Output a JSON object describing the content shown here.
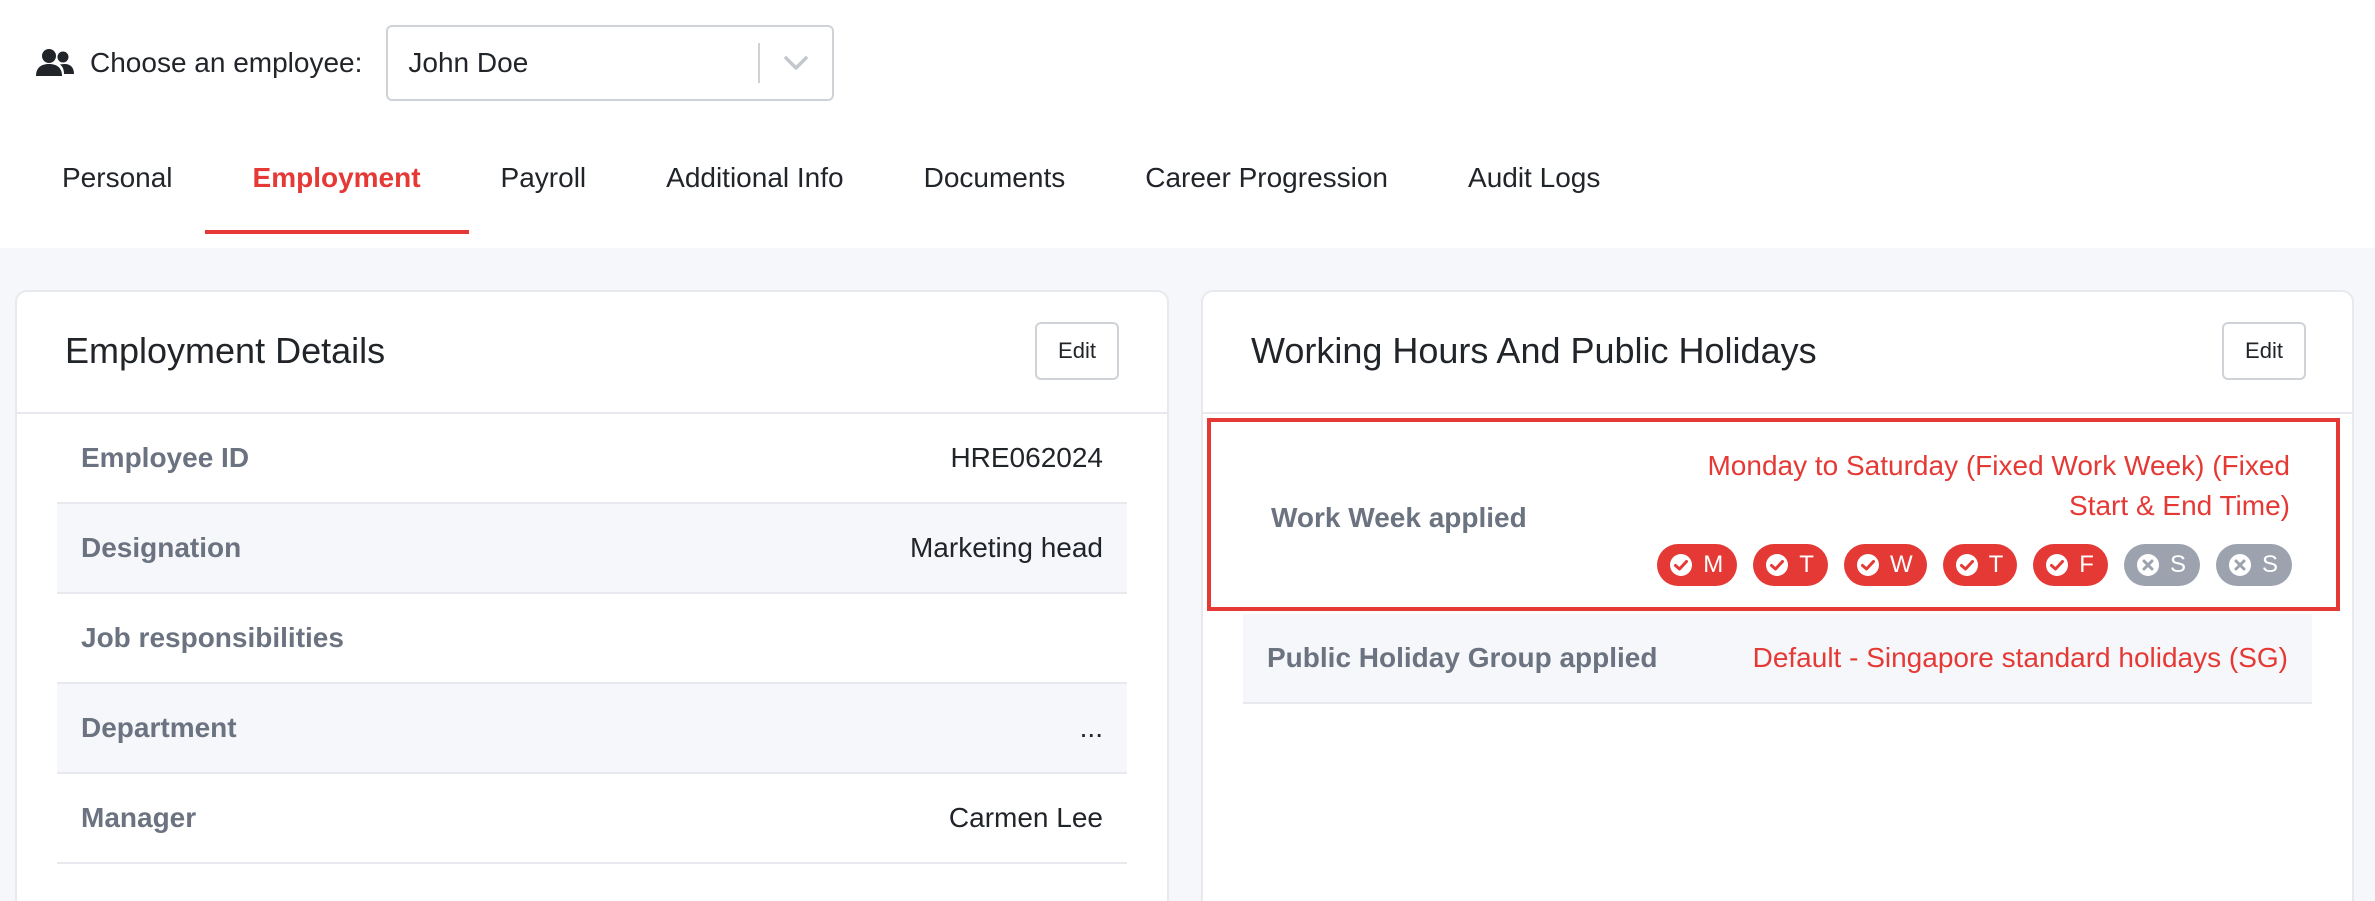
{
  "employee_select": {
    "label": "Choose an employee:",
    "selected": "John Doe",
    "icon": "people-icon",
    "chevron_icon": "chevron-down-icon"
  },
  "tabs": [
    {
      "label": "Personal",
      "active": false
    },
    {
      "label": "Employment",
      "active": true
    },
    {
      "label": "Payroll",
      "active": false
    },
    {
      "label": "Additional Info",
      "active": false
    },
    {
      "label": "Documents",
      "active": false
    },
    {
      "label": "Career Progression",
      "active": false
    },
    {
      "label": "Audit Logs",
      "active": false
    }
  ],
  "employment_details": {
    "title": "Employment Details",
    "edit_label": "Edit",
    "rows": [
      {
        "label": "Employee ID",
        "value": "HRE062024"
      },
      {
        "label": "Designation",
        "value": "Marketing head"
      },
      {
        "label": "Job responsibilities",
        "value": ""
      },
      {
        "label": "Department",
        "value": "..."
      },
      {
        "label": "Manager",
        "value": "Carmen Lee"
      }
    ]
  },
  "working_hours": {
    "title": "Working Hours And Public Holidays",
    "edit_label": "Edit",
    "work_week": {
      "label": "Work Week applied",
      "value": "Monday to Saturday (Fixed Work Week) (Fixed Start & End Time)",
      "days": [
        {
          "letter": "M",
          "working": true
        },
        {
          "letter": "T",
          "working": true
        },
        {
          "letter": "W",
          "working": true
        },
        {
          "letter": "T",
          "working": true
        },
        {
          "letter": "F",
          "working": true
        },
        {
          "letter": "S",
          "working": false
        },
        {
          "letter": "S",
          "working": false
        }
      ]
    },
    "public_holiday": {
      "label": "Public Holiday Group applied",
      "value": "Default - Singapore standard holidays (SG)"
    }
  },
  "colors": {
    "accent": "#e53935",
    "muted_label": "#6b7280",
    "pill_off": "#9ca3af",
    "stripe": "#f6f7fa"
  }
}
